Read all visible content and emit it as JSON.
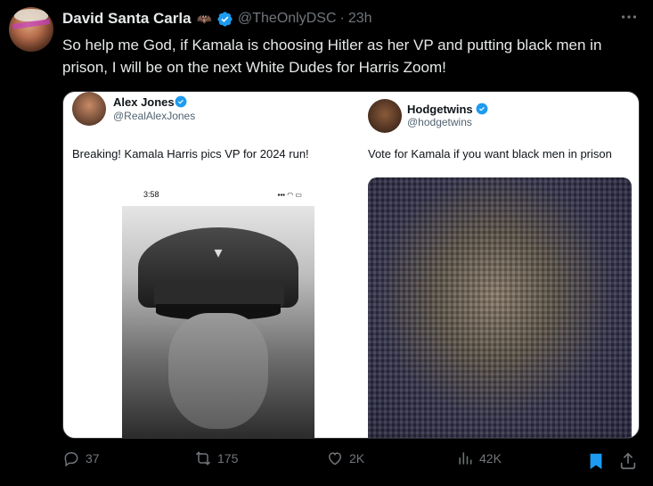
{
  "post": {
    "author_name": "David Santa Carla",
    "name_emoji": "🦇",
    "handle": "@TheOnlyDSC",
    "separator": "·",
    "time": "23h",
    "text": "So help me God, if Kamala is choosing Hitler as her VP and putting black men in prison, I will be on the next White Dudes for Harris Zoom!"
  },
  "media": {
    "left": {
      "name": "Alex Jones",
      "handle": "@RealAlexJones",
      "text": "Breaking! Kamala Harris pics VP for 2024 run!",
      "phone_time": "3:58"
    },
    "right": {
      "name": "Hodgetwins",
      "handle": "@hodgetwins",
      "text": "Vote for Kamala if you want black men in prison"
    }
  },
  "actions": {
    "replies": "37",
    "reposts": "175",
    "likes": "2K",
    "views": "42K"
  },
  "colors": {
    "background": "#000000",
    "text": "#e7e9ea",
    "muted": "#71767b",
    "verified": "#1d9bf0",
    "bookmark": "#1d9bf0"
  }
}
